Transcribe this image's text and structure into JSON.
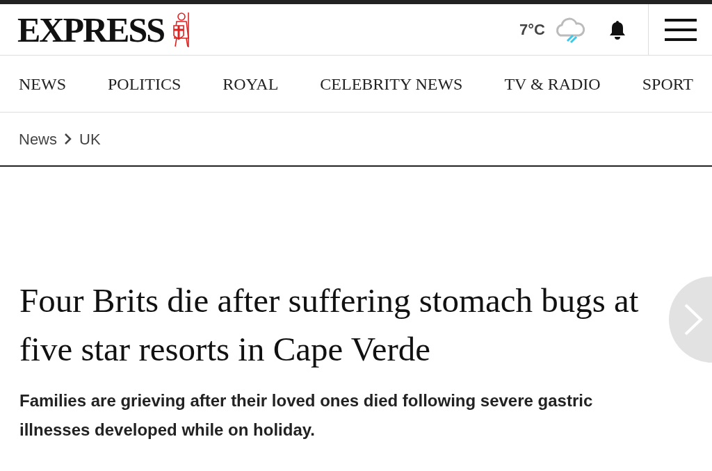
{
  "header": {
    "logo": "EXPRESS",
    "temperature": "7°C"
  },
  "nav": [
    {
      "label": "NEWS"
    },
    {
      "label": "POLITICS"
    },
    {
      "label": "ROYAL"
    },
    {
      "label": "CELEBRITY NEWS"
    },
    {
      "label": "TV & RADIO"
    },
    {
      "label": "SPORT"
    }
  ],
  "breadcrumb": [
    "News",
    "UK"
  ],
  "article": {
    "headline": "Four Brits die after suffering stomach bugs at five star resorts in Cape Verde",
    "standfirst": "Families are grieving after their loved ones died following severe gastric illnesses developed while on holiday."
  }
}
